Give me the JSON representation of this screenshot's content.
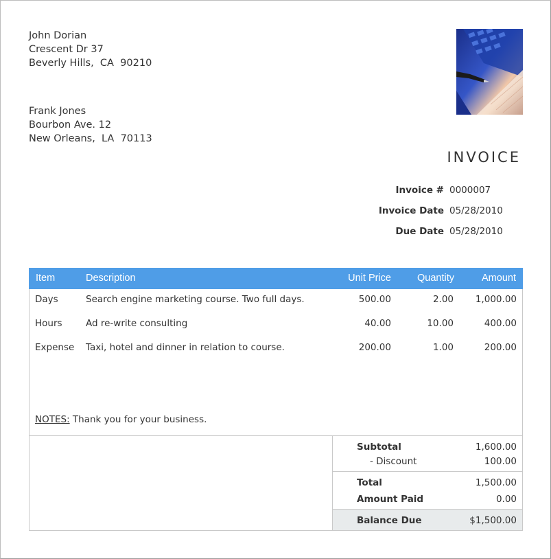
{
  "sender": {
    "name": "John Dorian",
    "street": "Crescent Dr 37",
    "city_line": "Beverly Hills,  CA  90210"
  },
  "recipient": {
    "name": "Frank Jones",
    "street": "Bourbon Ave. 12",
    "city_line": "New Orleans,  LA  70113"
  },
  "title": "INVOICE",
  "meta": {
    "invoice_number_label": "Invoice #",
    "invoice_number": "0000007",
    "invoice_date_label": "Invoice Date",
    "invoice_date": "05/28/2010",
    "due_date_label": "Due Date",
    "due_date": "05/28/2010"
  },
  "table": {
    "headers": [
      "Item",
      "Description",
      "Unit Price",
      "Quantity",
      "Amount"
    ],
    "rows": [
      {
        "item": "Days",
        "description": "Search engine marketing course. Two full days.",
        "unit_price": "500.00",
        "quantity": "2.00",
        "amount": "1,000.00"
      },
      {
        "item": "Hours",
        "description": "Ad re-write consulting",
        "unit_price": "40.00",
        "quantity": "10.00",
        "amount": "400.00"
      },
      {
        "item": "Expense",
        "description": "Taxi, hotel and dinner in relation to course.",
        "unit_price": "200.00",
        "quantity": "1.00",
        "amount": "200.00"
      }
    ]
  },
  "notes": {
    "label": "NOTES:",
    "text": "Thank you for your business."
  },
  "totals": {
    "subtotal_label": "Subtotal",
    "subtotal": "1,600.00",
    "discount_label": "-  Discount",
    "discount": "100.00",
    "total_label": "Total",
    "total": "1,500.00",
    "amount_paid_label": "Amount Paid",
    "amount_paid": "0.00",
    "balance_due_label": "Balance Due",
    "balance_due": "$1,500.00"
  },
  "colors": {
    "header_blue": "#4f9de7",
    "balance_bg": "#e8ebec"
  },
  "photo_icon": "keyboard-pen-photo"
}
